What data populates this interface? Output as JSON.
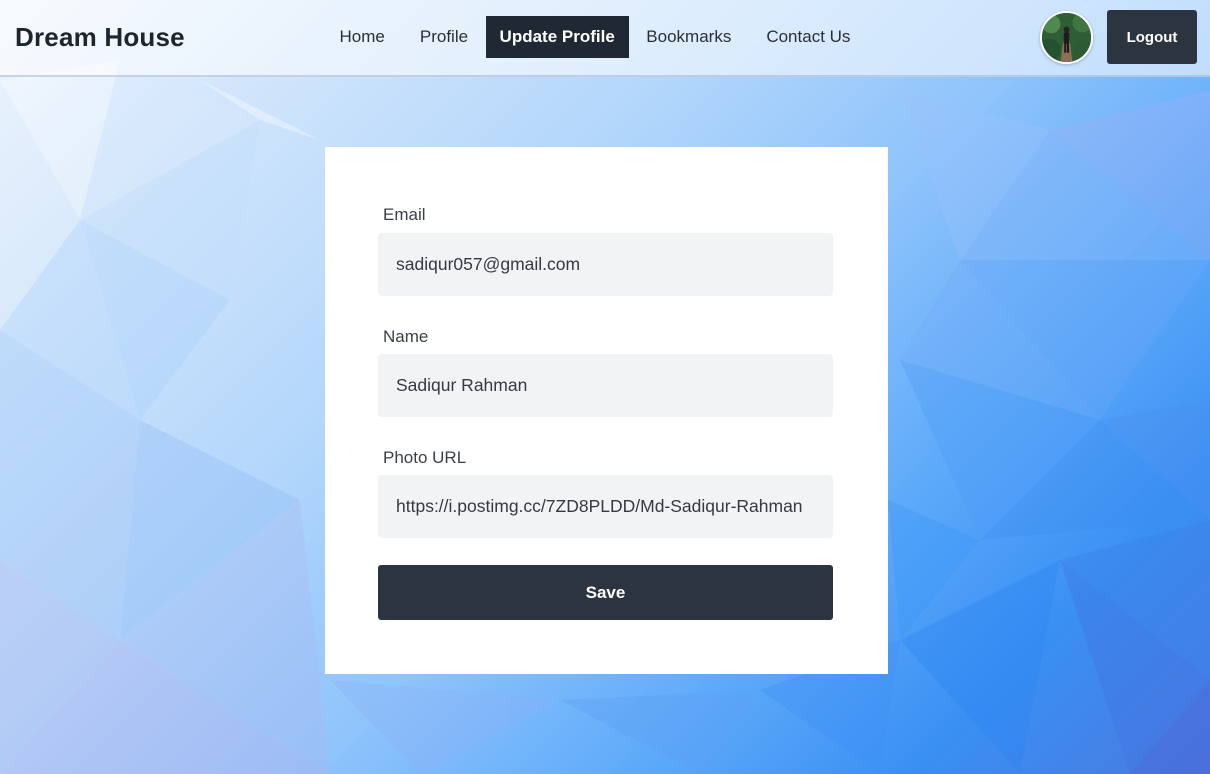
{
  "app": {
    "brand": "Dream House"
  },
  "nav": {
    "items": [
      {
        "label": "Home",
        "active": false
      },
      {
        "label": "Profile",
        "active": false
      },
      {
        "label": "Update Profile",
        "active": true
      },
      {
        "label": "Bookmarks",
        "active": false
      },
      {
        "label": "Contact Us",
        "active": false
      }
    ],
    "logout_label": "Logout",
    "avatar_icon": "user-avatar-photo"
  },
  "form": {
    "email": {
      "label": "Email",
      "value": "sadiqur057@gmail.com"
    },
    "name": {
      "label": "Name",
      "value": "Sadiqur Rahman"
    },
    "photo_url": {
      "label": "Photo URL",
      "value": "https://i.postimg.cc/7ZD8PLDD/Md-Sadiqur-Rahman"
    },
    "save_label": "Save"
  },
  "colors": {
    "dark_button": "#2c3440",
    "active_nav": "#202833",
    "input_bg": "#f2f3f5"
  }
}
